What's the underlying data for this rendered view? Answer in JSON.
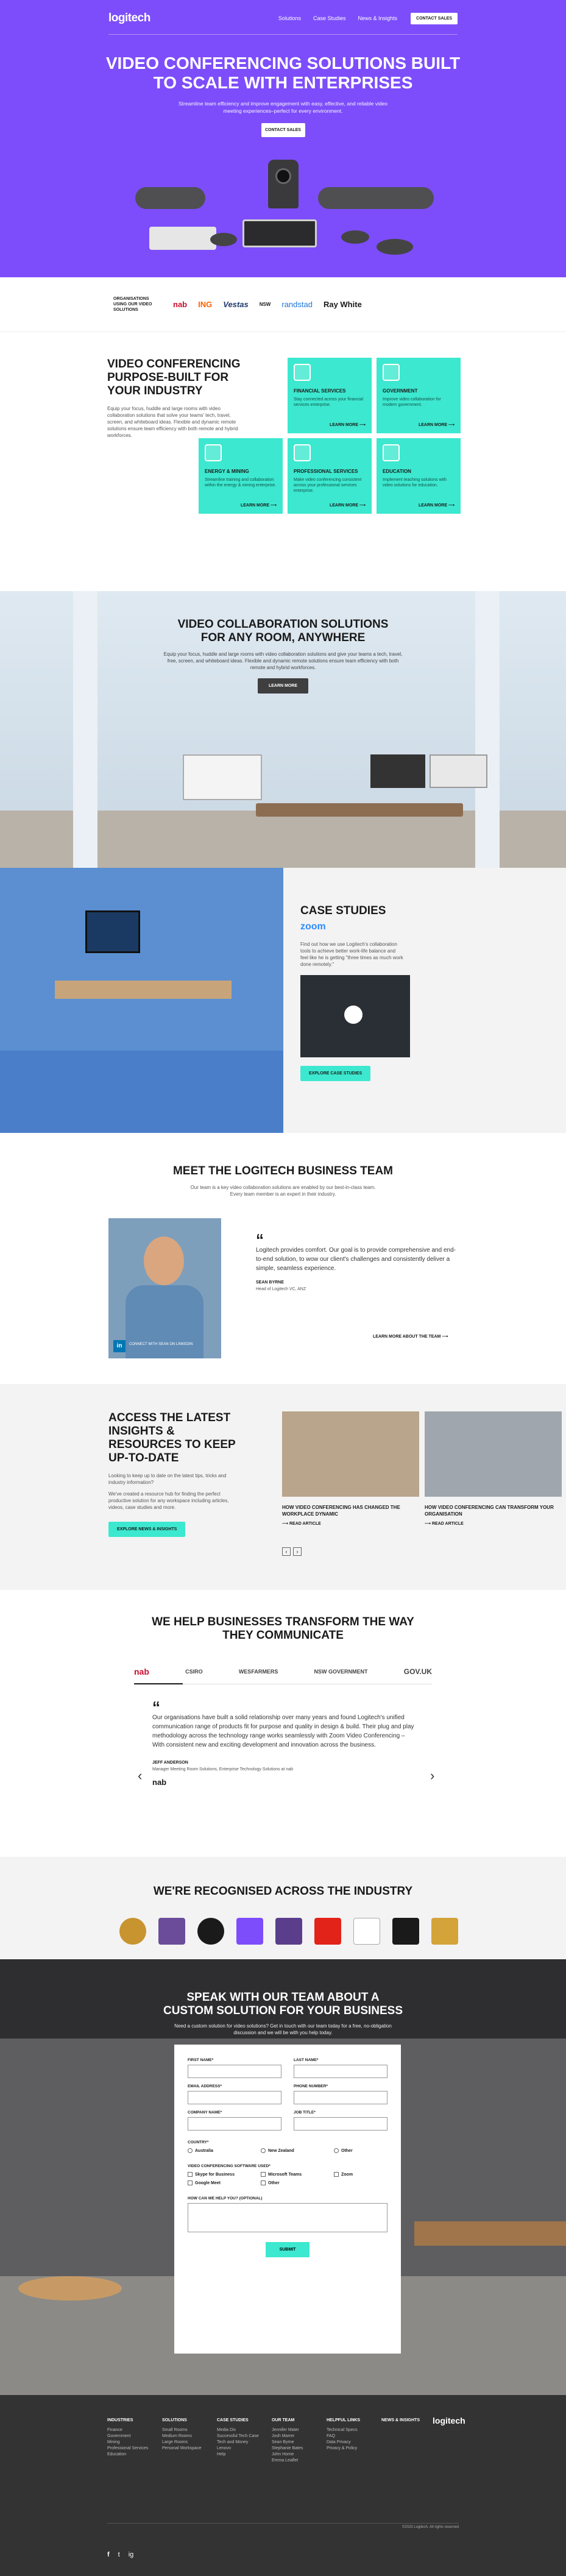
{
  "nav": {
    "logo": "logitech",
    "links": [
      "Solutions",
      "Case Studies",
      "News & Insights"
    ],
    "cta": "CONTACT SALES"
  },
  "hero": {
    "title_l1": "VIDEO CONFERENCING SOLUTIONS BUILT",
    "title_l2": "TO SCALE WITH ENTERPRISES",
    "subtitle": "Streamline team efficiency and improve engagement with easy, effective, and reliable video meeting experiences–perfect for every environment.",
    "cta": "CONTACT SALES"
  },
  "clients": {
    "label": "ORGANISATIONS USING OUR VIDEO SOLUTIONS",
    "logos": [
      "nab",
      "ING",
      "Vestas",
      "NSW",
      "randstad",
      "Ray White"
    ]
  },
  "industry": {
    "title_l1": "VIDEO CONFERENCING",
    "title_l2": "PURPOSE-BUILT FOR",
    "title_l3": "YOUR INDUSTRY",
    "text": "Equip your focus, huddle and large rooms with video collaboration solutions that solve your teams' tech, travel, screen, and whiteboard ideas. Flexible and dynamic remote solutions ensure team efficiency with both remote and hybrid workforces.",
    "more": "LEARN MORE",
    "cards": [
      {
        "title": "FINANCIAL SERVICES",
        "desc": "Stay connected across your financial services enterprise."
      },
      {
        "title": "GOVERNMENT",
        "desc": "Improve video collaboration for modern government."
      },
      {
        "title": "ENERGY & MINING",
        "desc": "Streamline training and collaboration within the energy & mining enterprise."
      },
      {
        "title": "PROFESSIONAL SERVICES",
        "desc": "Make video conferencing consistent across your professional services enterprise."
      },
      {
        "title": "EDUCATION",
        "desc": "Implement teaching solutions with video solutions for education."
      }
    ]
  },
  "collab": {
    "title_l1": "VIDEO COLLABORATION SOLUTIONS",
    "title_l2": "FOR ANY ROOM, ANYWHERE",
    "subtitle": "Equip your focus, huddle and large rooms with video collaboration solutions and give your teams a tech, travel, free, screen, and whiteboard ideas. Flexible and dynamic remote solutions ensure team efficiency with both remote and hybrid workforces.",
    "cta": "LEARN MORE"
  },
  "case": {
    "title": "CASE STUDIES",
    "brand": "zoom",
    "text": "Find out how we use Logitech's collaboration tools to achieve better work-life balance and feel like he is getting \"three times as much work done remotely.\"",
    "cta": "EXPLORE CASE STUDIES"
  },
  "team": {
    "title": "MEET THE LOGITECH BUSINESS TEAM",
    "subtitle": "Our team is a key video collaboration solutions are enabled by our best-in-class team. Every team member is an expert in their industry.",
    "quote": "Logitech provides comfort. Our goal is to provide comprehensive and end-to-end solution, to wow our client's challenges and consistently deliver a simple, seamless experience.",
    "author": "SEAN BYRNE",
    "role": "Head of Logitech VC, ANZ",
    "caption": "CONNECT WITH SEAN ON LINKEDIN",
    "link": "LEARN MORE ABOUT THE TEAM"
  },
  "insights": {
    "title_l1": "ACCESS THE LATEST",
    "title_l2": "INSIGHTS &",
    "title_l3": "RESOURCES TO KEEP",
    "title_l4": "UP-TO-DATE",
    "text1": "Looking to keep up to date on the latest tips, tricks and industry information?",
    "text2": "We've created a resource hub for finding the perfect productive solution for any workspace including articles, videos, case studies and more.",
    "cta": "EXPLORE NEWS & INSIGHTS",
    "articles": [
      {
        "title": "HOW VIDEO CONFERENCING HAS CHANGED THE WORKPLACE DYNAMIC",
        "link": "READ ARTICLE"
      },
      {
        "title": "HOW VIDEO CONFERENCING CAN TRANSFORM YOUR ORGANISATION",
        "link": "READ ARTICLE"
      }
    ]
  },
  "transform": {
    "title_l1": "WE HELP BUSINESSES TRANSFORM THE WAY",
    "title_l2": "THEY COMMUNICATE",
    "tabs": [
      "nab",
      "CSIRO",
      "WESFARMERS",
      "NSW GOVERNMENT",
      "GOV.UK"
    ],
    "quote": "Our organisations have built a solid relationship over many years and found Logitech's unified communication range of products fit for purpose and quality in design & build. Their plug and play methodology across the technology range works seamlessly with Zoom Video Conferencing – With consistent new and exciting development and innovation across the business.",
    "author": "JEFF ANDERSON",
    "role": "Manager Meeting Room Solutions, Enterprise Technology Solutions at nab",
    "brand": "nab"
  },
  "awards": {
    "title": "WE'RE RECOGNISED ACROSS THE INDUSTRY"
  },
  "contact": {
    "title_l1": "SPEAK WITH OUR TEAM ABOUT A",
    "title_l2": "CUSTOM SOLUTION FOR YOUR BUSINESS",
    "subtitle": "Need a custom solution for video solutions? Get in touch with our team today for a free, no-obligation discussion and we will be with you help today.",
    "fields": {
      "first": "FIRST NAME*",
      "last": "LAST NAME*",
      "email": "EMAIL ADDRESS*",
      "phone": "PHONE NUMBER*",
      "company": "COMPANY NAME*",
      "job": "JOB TITLE*",
      "country": "COUNTRY*",
      "software": "VIDEO CONFERENCING SOFTWARE USED*",
      "hear": "HOW CAN WE HELP YOU? (OPTIONAL)"
    },
    "countries": [
      "Australia",
      "New Zealand",
      "Other"
    ],
    "software": [
      "Skype for Business",
      "Microsoft Teams",
      "Zoom",
      "Google Meet",
      "Other"
    ],
    "submit": "SUBMIT"
  },
  "footer": {
    "cols": [
      {
        "h": "INDUSTRIES",
        "items": [
          "Finance",
          "Government",
          "Mining",
          "Professional Services",
          "Education"
        ]
      },
      {
        "h": "SOLUTIONS",
        "items": [
          "Small Rooms",
          "Medium Rooms",
          "Large Rooms",
          "Personal Workspace"
        ]
      },
      {
        "h": "CASE STUDIES",
        "items": [
          "Media Div",
          "Successful Tech Case",
          "Tech and Money",
          "Lenovo",
          "Help"
        ]
      },
      {
        "h": "OUR TEAM",
        "items": [
          "Jennifer Mater",
          "Josh Marrer",
          "Sean Byrne",
          "Stephanie Bates",
          "John Horne",
          "Emma Leaflet"
        ]
      },
      {
        "h": "HELPFUL LINKS",
        "items": [
          "Technical Specs",
          "FAQ",
          "Data Privacy",
          "Privacy & Policy"
        ]
      },
      {
        "h": "NEWS & INSIGHTS",
        "items": []
      }
    ],
    "logo": "logitech",
    "copyright": "©2023 Logitech. All rights reserved",
    "social": [
      "f",
      "t",
      "ig"
    ]
  }
}
